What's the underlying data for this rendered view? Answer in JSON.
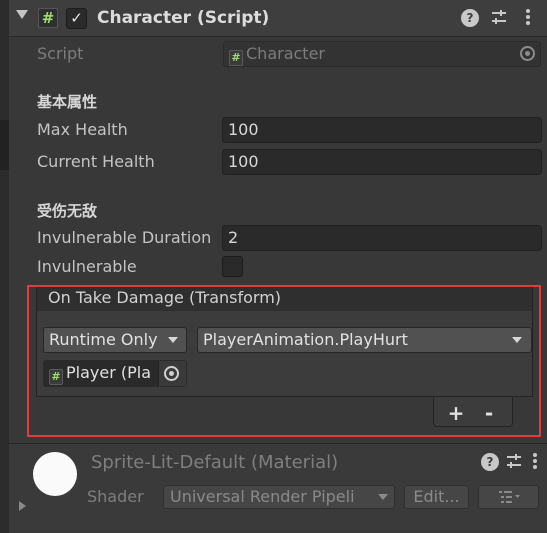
{
  "component": {
    "title": "Character (Script)",
    "enabled_check": "✓",
    "script_icon": "#"
  },
  "fields": {
    "script_label": "Script",
    "script_value": "Character",
    "section_basic": "基本属性",
    "max_health_label": "Max Health",
    "max_health_value": "100",
    "current_health_label": "Current Health",
    "current_health_value": "100",
    "section_invuln": "受伤无敌",
    "invuln_duration_label": "Invulnerable Duration",
    "invuln_duration_value": "2",
    "invulnerable_label": "Invulnerable"
  },
  "event": {
    "title": "On Take Damage (Transform)",
    "call_state": "Runtime Only",
    "function": "PlayerAnimation.PlayHurt",
    "target": "Player (Pla",
    "add_label": "+",
    "remove_label": "-"
  },
  "material": {
    "title": "Sprite-Lit-Default (Material)",
    "shader_label": "Shader",
    "shader_value": "Universal Render Pipeli",
    "edit_label": "Edit..."
  },
  "colors": {
    "background": "#383838",
    "highlight_frame": "#e33b3b",
    "script_icon": "#9adf6e"
  }
}
